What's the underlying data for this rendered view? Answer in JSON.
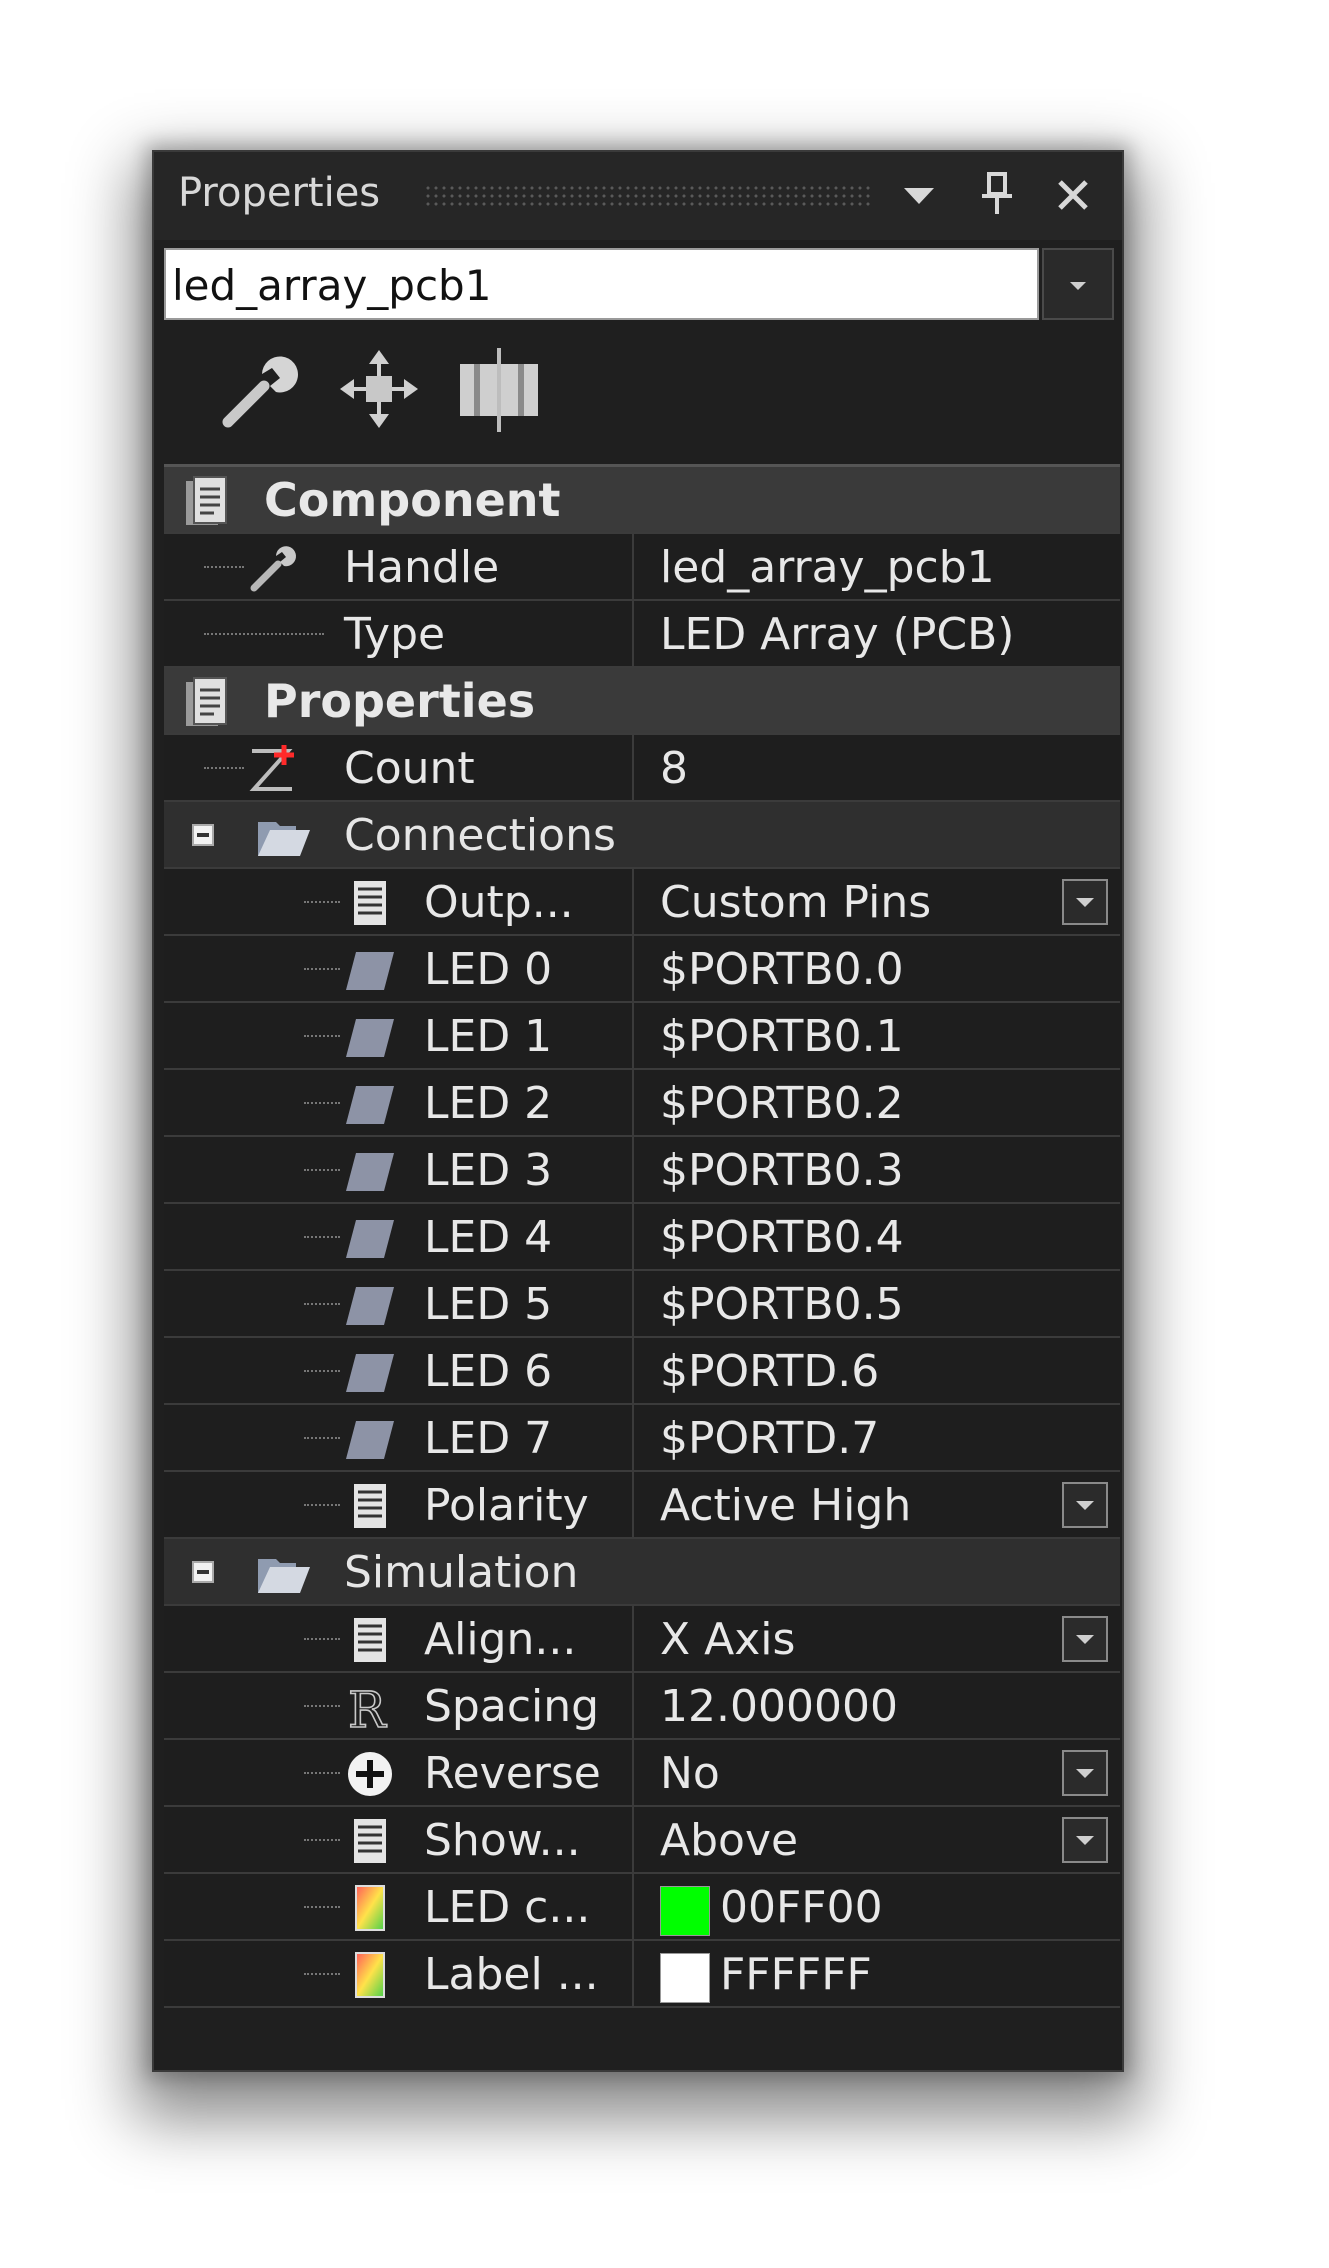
{
  "window": {
    "title": "Properties",
    "selected_object": "led_array_pcb1"
  },
  "toolbar": {
    "icons": [
      "wrench-icon",
      "move-icon",
      "resize-icon"
    ]
  },
  "sections": {
    "component": {
      "label": "Component",
      "rows": [
        {
          "label": "Handle",
          "value": "led_array_pcb1",
          "icon": "wrench-icon"
        },
        {
          "label": "Type",
          "value": "LED Array (PCB)",
          "icon": ""
        }
      ]
    },
    "properties": {
      "label": "Properties",
      "count": {
        "label": "Count",
        "value": "8",
        "icon": "z-expression-icon"
      },
      "connections": {
        "label": "Connections",
        "rows": [
          {
            "label": "Outp...",
            "value": "Custom Pins",
            "icon": "list-icon",
            "dropdown": true
          },
          {
            "label": "LED 0",
            "value": "$PORTB0.0",
            "icon": "pin-icon"
          },
          {
            "label": "LED 1",
            "value": "$PORTB0.1",
            "icon": "pin-icon"
          },
          {
            "label": "LED 2",
            "value": "$PORTB0.2",
            "icon": "pin-icon"
          },
          {
            "label": "LED 3",
            "value": "$PORTB0.3",
            "icon": "pin-icon"
          },
          {
            "label": "LED 4",
            "value": "$PORTB0.4",
            "icon": "pin-icon"
          },
          {
            "label": "LED 5",
            "value": "$PORTB0.5",
            "icon": "pin-icon"
          },
          {
            "label": "LED 6",
            "value": "$PORTD.6",
            "icon": "pin-icon"
          },
          {
            "label": "LED 7",
            "value": "$PORTD.7",
            "icon": "pin-icon"
          },
          {
            "label": "Polarity",
            "value": "Active High",
            "icon": "list-icon",
            "dropdown": true
          }
        ]
      },
      "simulation": {
        "label": "Simulation",
        "rows": [
          {
            "label": "Align...",
            "value": "X Axis",
            "icon": "list-icon",
            "dropdown": true
          },
          {
            "label": "Spacing",
            "value": "12.000000",
            "icon": "real-number-icon"
          },
          {
            "label": "Reverse",
            "value": "No",
            "icon": "plus-circle-icon",
            "dropdown": true
          },
          {
            "label": "Show...",
            "value": "Above",
            "icon": "list-icon",
            "dropdown": true
          },
          {
            "label": "LED c...",
            "value": "00FF00",
            "icon": "color-icon",
            "swatch": "#00ff00"
          },
          {
            "label": "Label ...",
            "value": "FFFFFF",
            "icon": "color-icon",
            "swatch": "#ffffff"
          }
        ]
      }
    }
  }
}
